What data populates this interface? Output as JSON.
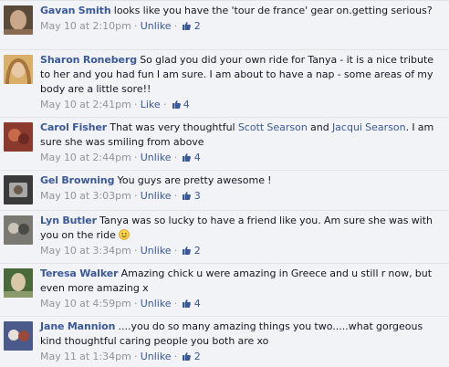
{
  "comments": [
    {
      "author": "Gavan Smith",
      "text": "looks like you have the 'tour de france' gear on.getting serious?",
      "date": "May 10 at 2:10pm",
      "action": "Unlike",
      "likes": "2",
      "avatar_colors": [
        "#5a4a3a",
        "#c9a78a",
        "#8a6c52"
      ]
    },
    {
      "author": "Sharon Roneberg",
      "text": "So glad you did your own ride for Tanya - it is a nice tribute to her and you had fun I am sure. I am about to have a nap - some areas of my body are a little sore!!",
      "date": "May 10 at 2:41pm",
      "action": "Like",
      "likes": "4",
      "avatar_colors": [
        "#d8b06a",
        "#e8c9a6",
        "#a9763e"
      ]
    },
    {
      "author": "Carol Fisher",
      "text_parts": [
        "That was very thoughtful ",
        " and ",
        ". I am sure she was smiling from above"
      ],
      "mentions": [
        "Scott Searson",
        "Jacqui Searson"
      ],
      "date": "May 10 at 2:44pm",
      "action": "Unlike",
      "likes": "4",
      "avatar_colors": [
        "#8b3a2e",
        "#c76a4a",
        "#6b2a22"
      ]
    },
    {
      "author": "Gel Browning",
      "text": "You guys are pretty awesome !",
      "date": "May 10 at 3:03pm",
      "action": "Unlike",
      "likes": "3",
      "avatar_colors": [
        "#3a3a3a",
        "#a8a8a8",
        "#6a5a4a"
      ]
    },
    {
      "author": "Lyn Butler",
      "text": "Tanya was so lucky to have a friend like you. Am sure she was with you on the ride",
      "date": "May 10 at 3:34pm",
      "action": "Unlike",
      "likes": "2",
      "avatar_colors": [
        "#7a7a72",
        "#c8c4b8",
        "#4a4a44"
      ]
    },
    {
      "author": "Teresa Walker",
      "text": "Amazing chick u were amazing in Greece and u still r now, but even more amazing x",
      "date": "May 10 at 4:59pm",
      "action": "Unlike",
      "likes": "4",
      "avatar_colors": [
        "#4a6a3a",
        "#d8c8a8",
        "#8a9a6a"
      ]
    },
    {
      "author": "Jane Mannion",
      "text": "....you do so many amazing things you two.....what gorgeous kind thoughtful caring people you both are xo",
      "date": "May 11 at 1:34pm",
      "action": "Unlike",
      "likes": "2",
      "avatar_colors": [
        "#4a5a8a",
        "#e8e0d8",
        "#9a4a3a"
      ]
    }
  ],
  "meta_separator": "·",
  "colors": {
    "link": "#3b5998",
    "background": "#f2f3f6",
    "meta_text": "#90949c"
  }
}
